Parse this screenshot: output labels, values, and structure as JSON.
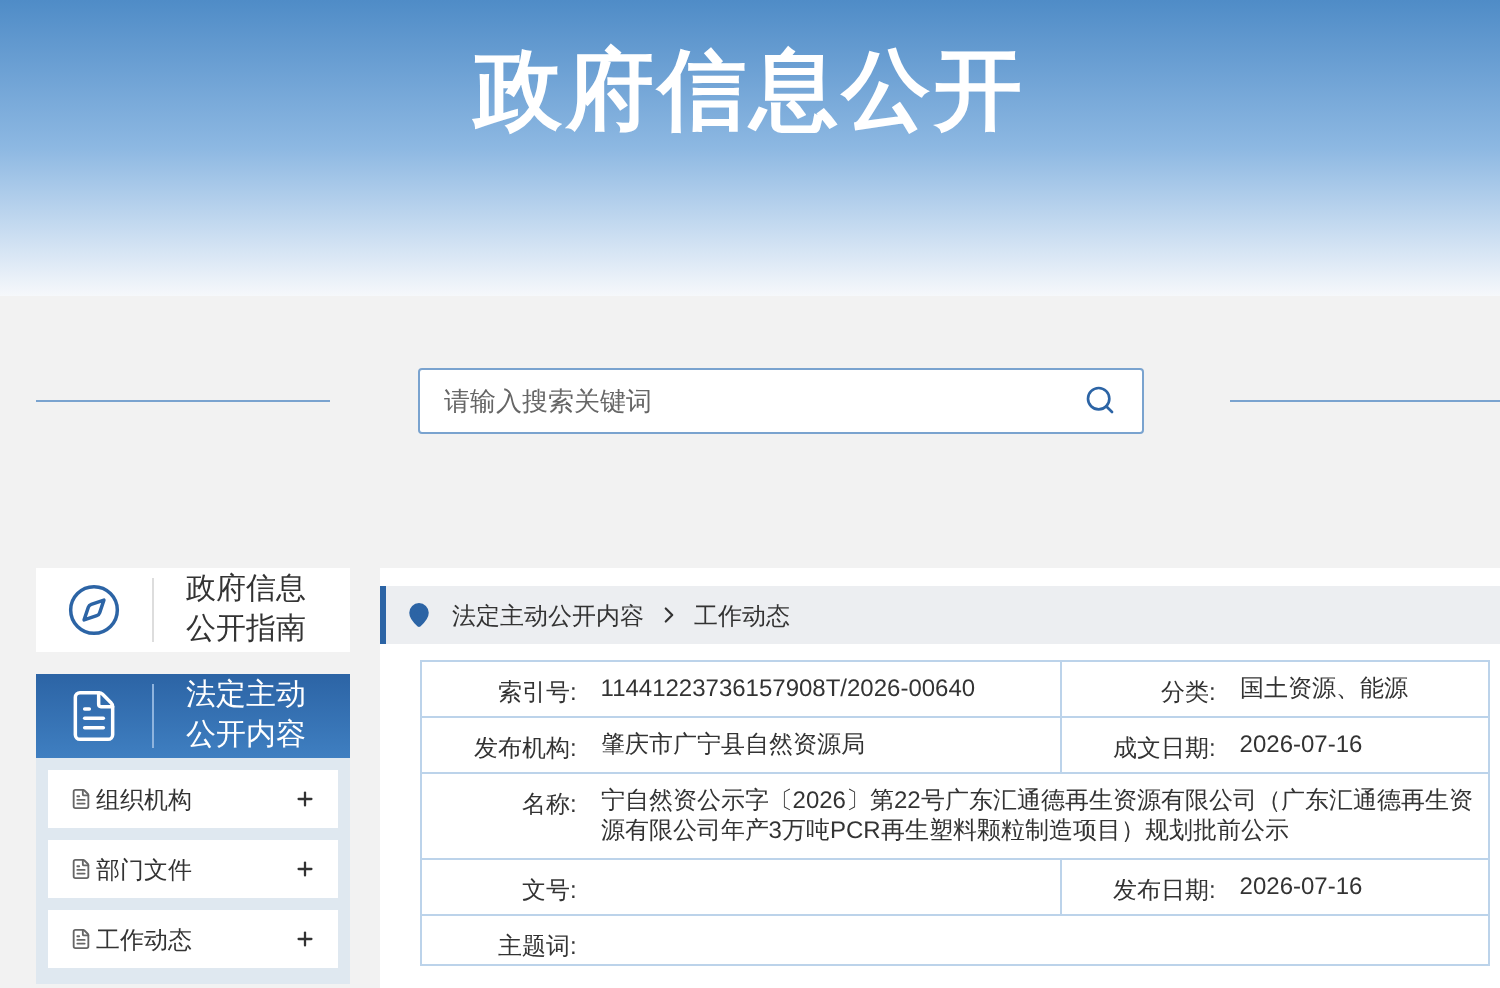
{
  "banner": {
    "title": "政府信息公开"
  },
  "search": {
    "placeholder": "请输入搜索关键词"
  },
  "sidebar": {
    "cards": [
      {
        "kind": "guide",
        "label": "政府信息公开指南",
        "selected": false
      },
      {
        "kind": "content",
        "label": "法定主动公开内容",
        "selected": true
      }
    ],
    "items": [
      {
        "label": "组织机构",
        "expanded": false
      },
      {
        "label": "部门文件",
        "expanded": false
      },
      {
        "label": "工作动态",
        "expanded": false
      }
    ]
  },
  "breadcrumb": [
    "法定主动公开内容",
    "工作动态"
  ],
  "info_table": {
    "rows": [
      {
        "kind": "pair",
        "cells": [
          {
            "label": "索引号:",
            "value": "11441223736157908T/2026-00640"
          },
          {
            "label": "分类:",
            "value": "国土资源、能源"
          }
        ]
      },
      {
        "kind": "pair",
        "cells": [
          {
            "label": "发布机构:",
            "value": "肇庆市广宁县自然资源局"
          },
          {
            "label": "成文日期:",
            "value": "2026-07-16"
          }
        ]
      },
      {
        "kind": "wide",
        "cells": [
          {
            "label": "名称:",
            "value": "宁自然资公示字〔2026〕第22号广东汇通德再生资源有限公司（广东汇通德再生资源有限公司年产3万吨PCR再生塑料颗粒制造项目）规划批前公示"
          }
        ]
      },
      {
        "kind": "pair",
        "cells": [
          {
            "label": "文号:"
          },
          {
            "label": "发布日期:",
            "value": "2026-07-16"
          }
        ]
      },
      {
        "kind": "wide",
        "cells": [
          {
            "label": "主题词:"
          }
        ]
      }
    ]
  }
}
